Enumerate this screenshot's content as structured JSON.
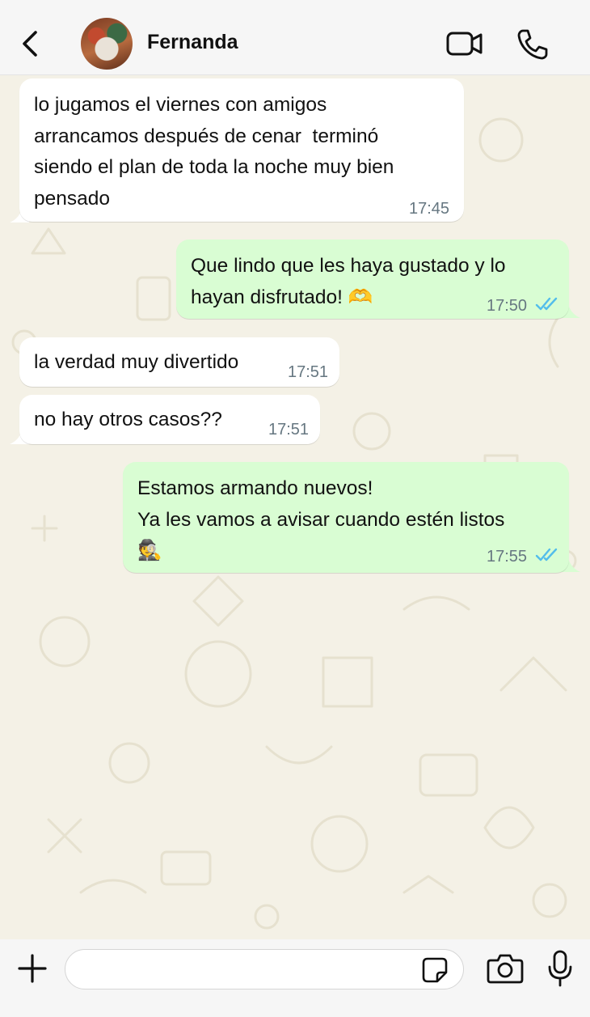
{
  "header": {
    "contact_name": "Fernanda",
    "icons": [
      "back-arrow-icon",
      "avatar",
      "video-call-icon",
      "phone-icon"
    ]
  },
  "messages": [
    {
      "direction": "in",
      "text": "lo jugamos el viernes con amigos\narrancamos después de cenar  terminó\nsiendo el plan de toda la noche muy bien\npensado",
      "time": "17:45"
    },
    {
      "direction": "out",
      "text": "Que lindo que les haya gustado y lo\nhayan disfrutado! 🫶",
      "time": "17:50",
      "status": "read"
    },
    {
      "direction": "in",
      "text": "la verdad muy divertido",
      "time": "17:51"
    },
    {
      "direction": "in",
      "text": "no hay otros casos??",
      "time": "17:51"
    },
    {
      "direction": "out",
      "text": "Estamos armando nuevos!\nYa les vamos a avisar cuando estén listos\n🕵️",
      "time": "17:55",
      "status": "read"
    }
  ],
  "composer": {
    "placeholder": "",
    "value": "",
    "icons": [
      "plus-icon",
      "sticker-icon",
      "camera-icon",
      "microphone-icon"
    ]
  },
  "colors": {
    "incoming_bubble": "#ffffff",
    "outgoing_bubble": "#d9fdd3",
    "read_ticks": "#53bdeb",
    "wallpaper": "#f4f1e6",
    "timestamp": "#667781"
  }
}
